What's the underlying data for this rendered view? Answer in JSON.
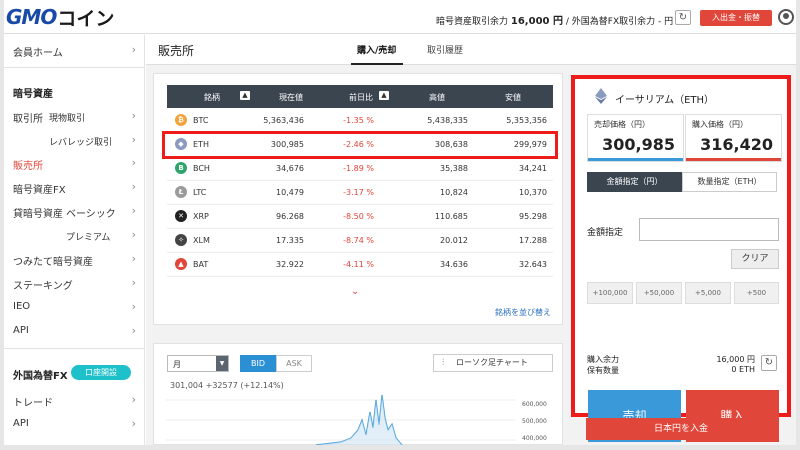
{
  "header": {
    "logo_gmo": "GMO",
    "logo_coin": "コイン",
    "crypto_balance_label": "暗号資産取引余力",
    "crypto_balance_value": "16,000 円",
    "separator": "/",
    "fx_balance_label": "外国為替FX取引余力 -",
    "fx_balance_unit": "円",
    "deposit_button": "入出金・振替"
  },
  "sidebar": {
    "member_home": "会員ホーム",
    "crypto_heading": "暗号資産",
    "exchange": "取引所",
    "spot": "現物取引",
    "leverage": "レバレッジ取引",
    "sales": "販売所",
    "crypto_fx": "暗号資産FX",
    "lending": "貸暗号資産",
    "basic": "ベーシック",
    "premium": "プレミアム",
    "tsumitate": "つみたて暗号資産",
    "staking": "ステーキング",
    "ieo": "IEO",
    "api": "API",
    "fx_heading": "外国為替FX",
    "open_account": "口座開設",
    "trade": "トレード",
    "fx_api": "API",
    "chevron": "›"
  },
  "main": {
    "title": "販売所",
    "tabs": [
      "購入/売却",
      "取引履歴"
    ]
  },
  "table": {
    "headers": [
      "銘柄",
      "現在値",
      "前日比",
      "高値",
      "安値"
    ],
    "sort_glyph": "▲",
    "rows": [
      {
        "symbol": "BTC",
        "price": "5,363,436",
        "change": "-1.35 %",
        "high": "5,438,335",
        "low": "5,353,356",
        "color": "#f2a33a",
        "glyph": "₿"
      },
      {
        "symbol": "ETH",
        "price": "300,985",
        "change": "-2.46 %",
        "high": "308,638",
        "low": "299,979",
        "color": "#8a9bbf",
        "glyph": "◆"
      },
      {
        "symbol": "BCH",
        "price": "34,676",
        "change": "-1.89 %",
        "high": "35,388",
        "low": "34,241",
        "color": "#2ea56b",
        "glyph": "B"
      },
      {
        "symbol": "LTC",
        "price": "10,479",
        "change": "-3.17 %",
        "high": "10,824",
        "low": "10,370",
        "color": "#9a9a9a",
        "glyph": "Ł"
      },
      {
        "symbol": "XRP",
        "price": "96.268",
        "change": "-8.50 %",
        "high": "110.685",
        "low": "95.298",
        "color": "#222222",
        "glyph": "✕"
      },
      {
        "symbol": "XLM",
        "price": "17.335",
        "change": "-8.74 %",
        "high": "20.012",
        "low": "17.288",
        "color": "#444444",
        "glyph": "✧"
      },
      {
        "symbol": "BAT",
        "price": "32.922",
        "change": "-4.11 %",
        "high": "34.636",
        "low": "32.643",
        "color": "#e0463a",
        "glyph": "▲"
      }
    ],
    "more_glyph": "⌄",
    "reorder_link": "銘柄を並び替え"
  },
  "chart": {
    "period": "月",
    "bid": "BID",
    "ask": "ASK",
    "candle_button": "ローソク足チャート",
    "info": "301,004 +32577 (+12.14%)",
    "y_labels": [
      "600,000",
      "500,000",
      "400,000"
    ]
  },
  "order": {
    "coin_name": "イーサリアム（ETH）",
    "sell_price_label": "売却価格（円）",
    "sell_price": "300,985",
    "buy_price_label": "購入価格（円）",
    "buy_price": "316,420",
    "mode_amount": "金額指定（円）",
    "mode_qty": "数量指定（ETH）",
    "amount_label": "金額指定",
    "clear": "クリア",
    "quick": [
      "+100,000",
      "+50,000",
      "+5,000",
      "+500"
    ],
    "buying_power_label": "購入余力",
    "buying_power_value": "16,000 円",
    "holding_label": "保有数量",
    "holding_value": "0 ETH",
    "sell_button": "売却",
    "buy_button": "購入",
    "deposit_jpy": "日本円を入金"
  },
  "colors": {
    "accent_red": "#e0463a",
    "highlight_red": "#ee1b1b",
    "table_header": "#3b4550",
    "sell_blue": "#3a9ad9",
    "account_teal": "#1ec0c9"
  }
}
